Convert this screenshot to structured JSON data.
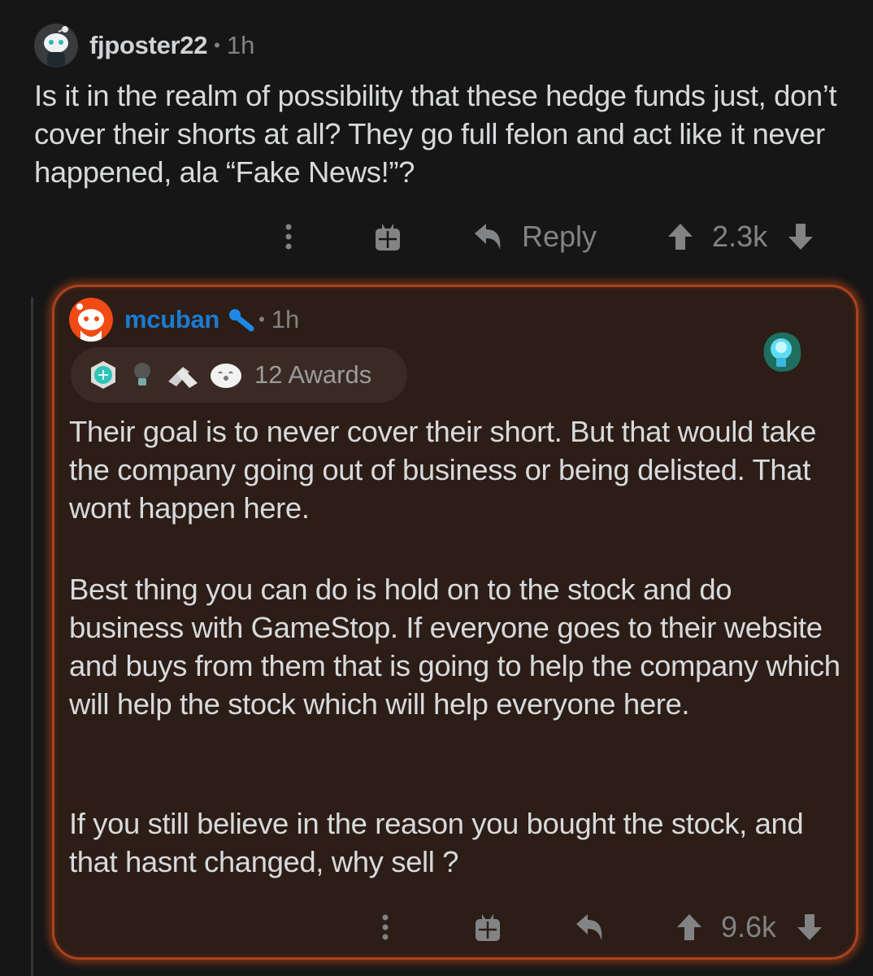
{
  "parent_comment": {
    "username": "fjposter22",
    "separator": "•",
    "time": "1h",
    "avatar_icon": "snoo-avatar-icon",
    "body": "Is it in the realm of possibility that these hedge funds just, don’t cover their shorts at all? They go full felon and act like it never happened, ala “Fake News!”?",
    "actions": {
      "more_icon": "more-vertical-icon",
      "give_award_icon": "gift-icon",
      "reply_icon": "reply-arrow-icon",
      "reply_label": "Reply",
      "upvote_icon": "upvote-arrow-icon",
      "score": "2.3k",
      "downvote_icon": "downvote-arrow-icon"
    }
  },
  "reply_comment": {
    "username": "mcuban",
    "username_color": "#1a7bd1",
    "verified_icon": "microphone-icon",
    "separator": "•",
    "time": "1h",
    "avatar_icon": "snoo-avatar-icon",
    "awards": {
      "icons": [
        "moderator-badge-award-icon",
        "lightbulb-award-icon",
        "handshake-award-icon",
        "seal-award-icon"
      ],
      "label": "12 Awards"
    },
    "flair_icon": "glowing-lightbulb-icon",
    "paragraphs": [
      "Their goal is to never cover their short.  But that would take the company going out of business or being delisted. That wont happen here.",
      "Best thing you can do is hold on to the stock and do business with GameStop. If everyone goes to their website and buys from them that is going to help the company which will help the stock which will help everyone here.",
      "If you still believe in the reason you bought the stock, and that hasnt changed, why sell ?"
    ],
    "actions": {
      "more_icon": "more-vertical-icon",
      "give_award_icon": "gift-icon",
      "reply_icon": "reply-arrow-icon",
      "upvote_icon": "upvote-arrow-icon",
      "score": "9.6k",
      "downvote_icon": "downvote-arrow-icon"
    },
    "highlight_color": "#c94a1a"
  }
}
